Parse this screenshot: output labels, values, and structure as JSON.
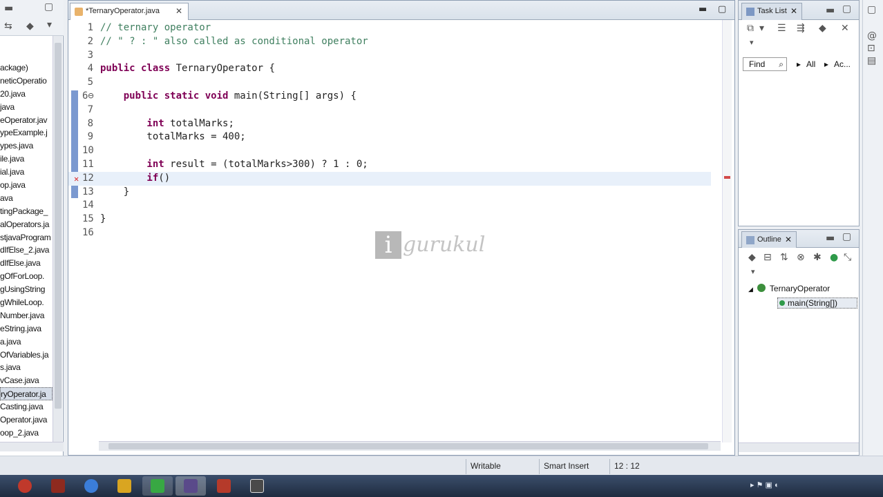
{
  "editor": {
    "tab_title": "*TernaryOperator.java",
    "lines": [
      {
        "num": "1",
        "tokens": [
          {
            "t": "// ternary operator",
            "c": "cm"
          }
        ]
      },
      {
        "num": "2",
        "tokens": [
          {
            "t": "// \" ? : \" also called as conditional operator",
            "c": "cm"
          }
        ]
      },
      {
        "num": "3",
        "tokens": []
      },
      {
        "num": "4",
        "tokens": [
          {
            "t": "public class ",
            "c": "kw"
          },
          {
            "t": "TernaryOperator {",
            "c": ""
          }
        ]
      },
      {
        "num": "5",
        "tokens": []
      },
      {
        "num": "6⊖",
        "tokens": [
          {
            "t": "    public static void ",
            "c": "kw"
          },
          {
            "t": "main(String[] args) {",
            "c": ""
          }
        ]
      },
      {
        "num": "7",
        "tokens": []
      },
      {
        "num": "8",
        "tokens": [
          {
            "t": "        int ",
            "c": "kw"
          },
          {
            "t": "totalMarks;",
            "c": ""
          }
        ]
      },
      {
        "num": "9",
        "tokens": [
          {
            "t": "        totalMarks = 400;",
            "c": ""
          }
        ]
      },
      {
        "num": "10",
        "tokens": []
      },
      {
        "num": "11",
        "tokens": [
          {
            "t": "        int ",
            "c": "kw"
          },
          {
            "t": "result = (totalMarks>300) ? 1 : 0;",
            "c": ""
          }
        ]
      },
      {
        "num": "12",
        "tokens": [
          {
            "t": "        if",
            "c": "kw"
          },
          {
            "t": "()",
            "c": ""
          }
        ],
        "current": true,
        "error": true
      },
      {
        "num": "13",
        "tokens": [
          {
            "t": "    }",
            "c": ""
          }
        ]
      },
      {
        "num": "14",
        "tokens": []
      },
      {
        "num": "15",
        "tokens": [
          {
            "t": "}",
            "c": ""
          }
        ]
      },
      {
        "num": "16",
        "tokens": []
      }
    ]
  },
  "package_explorer": {
    "items": [
      "ackage)",
      "neticOperatio",
      "20.java",
      "java",
      "eOperator.jav",
      "ypeExample.j",
      "ypes.java",
      "ile.java",
      "ial.java",
      "op.java",
      "ava",
      "tingPackage_",
      "alOperators.ja",
      "stjavaProgram",
      "dIfElse_2.java",
      "dIfElse.java",
      "gOfForLoop.",
      "gUsingString",
      "gWhileLoop.",
      "Number.java",
      "eString.java",
      "a.java",
      "OfVariables.ja",
      "s.java",
      "vCase.java",
      "ryOperator.ja",
      "Casting.java",
      "Operator.java",
      "oop_2.java"
    ],
    "selected_index": 25
  },
  "task_list": {
    "tab_title": "Task List",
    "find_label": "Find",
    "filter_all": "All",
    "filter_activate": "Ac..."
  },
  "outline": {
    "tab_title": "Outline",
    "class_name": "TernaryOperator",
    "method_name": "main(String[])"
  },
  "status": {
    "writable": "Writable",
    "insert_mode": "Smart Insert",
    "position": "12 : 12"
  },
  "watermark": {
    "letter": "i",
    "text": "gurukul"
  },
  "colors": {
    "keyword": "#7f0055",
    "comment": "#3f7f5f",
    "current_line": "#e8f0fa"
  }
}
